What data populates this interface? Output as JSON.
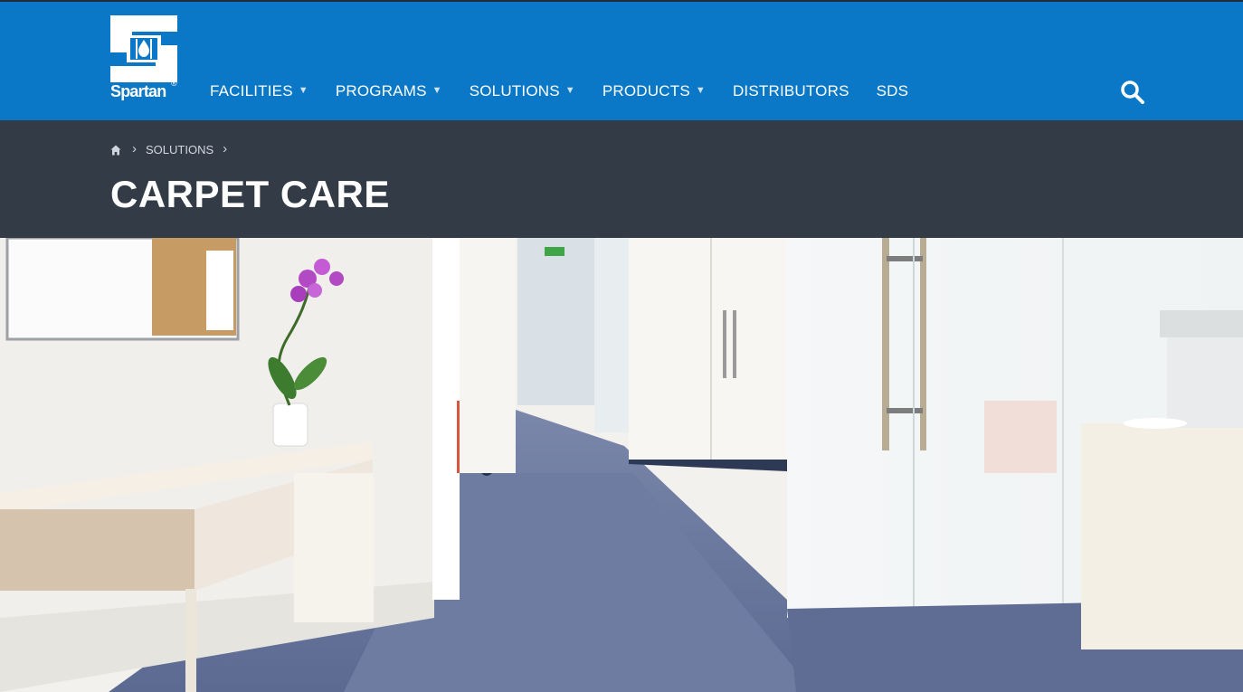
{
  "brand": {
    "name": "Spartan",
    "registered_mark": "®",
    "colors": {
      "header_blue": "#0a78c6",
      "banner_dark": "#333b47"
    }
  },
  "nav": {
    "items": [
      {
        "label": "FACILITIES",
        "has_dropdown": true
      },
      {
        "label": "PROGRAMS",
        "has_dropdown": true
      },
      {
        "label": "SOLUTIONS",
        "has_dropdown": true
      },
      {
        "label": "PRODUCTS",
        "has_dropdown": true
      },
      {
        "label": "DISTRIBUTORS",
        "has_dropdown": false
      },
      {
        "label": "SDS",
        "has_dropdown": false
      }
    ],
    "caret": "▼",
    "search_icon": "search-icon"
  },
  "breadcrumb": {
    "home_icon": "home-icon",
    "separator": "›",
    "items": [
      "SOLUTIONS"
    ]
  },
  "page": {
    "title": "CARPET CARE"
  },
  "hero": {
    "icon": "office-hallway-photo"
  }
}
